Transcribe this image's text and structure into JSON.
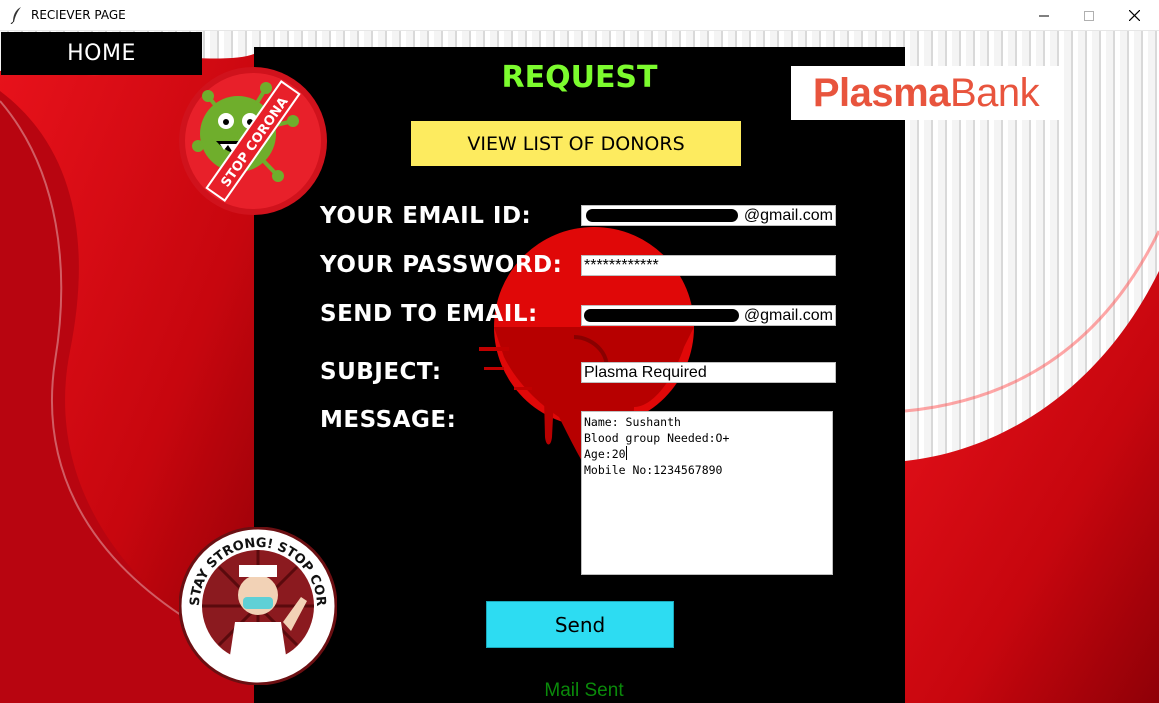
{
  "window": {
    "title": "RECIEVER PAGE"
  },
  "nav": {
    "home_label": "HOME"
  },
  "page": {
    "heading": "REQUEST",
    "view_donors_label": "VIEW LIST OF DONORS",
    "send_label": "Send",
    "status": "Mail Sent"
  },
  "logo": {
    "part1": "Plasma",
    "part2": "Bank"
  },
  "badges": {
    "top": "STOP CORONA",
    "bottom": "STAY STRONG! STOP CORONAVIRUS!"
  },
  "form": {
    "email_label": "YOUR EMAIL ID:",
    "email_value": "@gmail.com",
    "password_label": "YOUR PASSWORD:",
    "password_value": "************",
    "to_label": "SEND TO EMAIL:",
    "to_value": "@gmail.com",
    "subject_label": "SUBJECT:",
    "subject_value": "Plasma Required",
    "message_label": "MESSAGE:",
    "message_lines": [
      "Name: Sushanth",
      "Blood group Needed:O+",
      "Age:20",
      "Mobile No:1234567890"
    ]
  },
  "colors": {
    "heading": "#7cfc2e",
    "view_button": "#fdeb5f",
    "send_button": "#2ddcf2",
    "status": "#0a8a0a",
    "logo": "#e8543d"
  }
}
